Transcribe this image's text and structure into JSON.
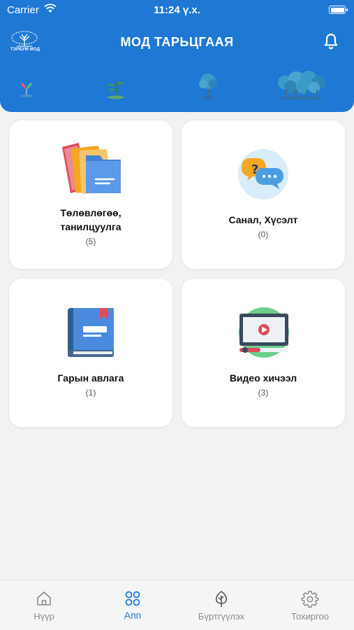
{
  "status_bar": {
    "carrier": "Carrier",
    "time": "11:24 ү.х."
  },
  "header": {
    "title": "МОД ТАРЬЦГААЯ",
    "logo_text": "ТЭРБУМ МОД",
    "notification_icon": "bell-icon"
  },
  "cards": [
    {
      "title_line1": "Төлөвлөгөө,",
      "title_line2": "танилцуулга",
      "count": "(5)",
      "icon": "folders-icon"
    },
    {
      "title": "Санал, Хүсэлт",
      "count": "(0)",
      "icon": "chat-bubbles-icon"
    },
    {
      "title": "Гарын авлага",
      "count": "(1)",
      "icon": "book-icon"
    },
    {
      "title": "Видео хичээл",
      "count": "(3)",
      "icon": "video-player-icon"
    }
  ],
  "tabs": [
    {
      "label": "Нүүр",
      "icon": "home-icon",
      "active": false
    },
    {
      "label": "Апп",
      "icon": "apps-grid-icon",
      "active": true
    },
    {
      "label": "Бүртгүүлэх",
      "icon": "tree-icon",
      "active": false
    },
    {
      "label": "Тохиргоо",
      "icon": "gear-icon",
      "active": false
    }
  ],
  "colors": {
    "primary": "#1e78d4",
    "background": "#f2f2f2",
    "card": "#ffffff"
  }
}
